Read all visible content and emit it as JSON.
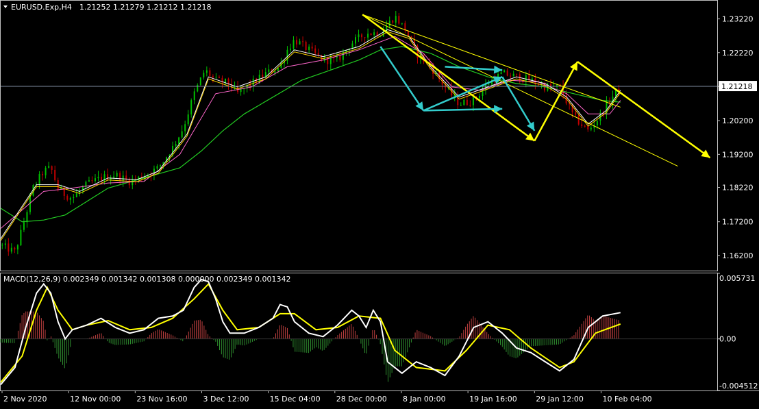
{
  "header": {
    "symbol": "EURUSD.Exp,H4",
    "ohlc": "1.21252 1.21279 1.21212 1.21218"
  },
  "macd_header": "MACD(12,26,9) 0.002349 0.001342 0.001308 0.000000 0.002349 0.001342",
  "colors": {
    "background": "#000000",
    "frame": "#c0c0c0",
    "bull_candle": "#00c000",
    "bear_candle": "#c00000",
    "ma_fast": "#ffffff",
    "ma_mid": "#ffd700",
    "ma_pink": "#ff66cc",
    "ma_slow": "#22cc22",
    "trend_yellow": "#ffff00",
    "trend_cyan": "#33cccc",
    "macd_main": "#ffffff",
    "macd_signal": "#ffff00",
    "hist_pos": "#c04040",
    "hist_neg": "#2f8f2f",
    "price_line": "#7f8ca0"
  },
  "chart_data": [
    {
      "type": "candlestick",
      "title": "EURUSD.Exp,H4",
      "ylim": [
        1.1575,
        1.2372
      ],
      "y_ticks": [
        "1.23220",
        "1.22220",
        "1.21218",
        "1.20200",
        "1.19200",
        "1.18220",
        "1.17200",
        "1.16200"
      ],
      "current_price": "1.21218",
      "x_ticks": [
        "2 Nov 2020",
        "12 Nov 00:00",
        "23 Nov 16:00",
        "3 Dec 12:00",
        "15 Dec 04:00",
        "28 Dec 00:00",
        "8 Jan 00:00",
        "19 Jan 16:00",
        "29 Jan 12:00",
        "10 Feb 04:00"
      ],
      "price_path": [
        [
          0,
          1.165
        ],
        [
          0.02,
          1.163
        ],
        [
          0.03,
          1.17
        ],
        [
          0.045,
          1.182
        ],
        [
          0.06,
          1.187
        ],
        [
          0.07,
          1.188
        ],
        [
          0.08,
          1.182
        ],
        [
          0.09,
          1.18
        ],
        [
          0.1,
          1.179
        ],
        [
          0.12,
          1.183
        ],
        [
          0.14,
          1.185
        ],
        [
          0.16,
          1.186
        ],
        [
          0.18,
          1.184
        ],
        [
          0.2,
          1.1855
        ],
        [
          0.22,
          1.188
        ],
        [
          0.24,
          1.194
        ],
        [
          0.255,
          1.2
        ],
        [
          0.27,
          1.21
        ],
        [
          0.285,
          1.217
        ],
        [
          0.3,
          1.214
        ],
        [
          0.32,
          1.213
        ],
        [
          0.33,
          1.21
        ],
        [
          0.35,
          1.213
        ],
        [
          0.37,
          1.216
        ],
        [
          0.39,
          1.218
        ],
        [
          0.4,
          1.223
        ],
        [
          0.41,
          1.226
        ],
        [
          0.43,
          1.223
        ],
        [
          0.45,
          1.22
        ],
        [
          0.47,
          1.22
        ],
        [
          0.49,
          1.225
        ],
        [
          0.51,
          1.228
        ],
        [
          0.53,
          1.228
        ],
        [
          0.55,
          1.233
        ],
        [
          0.565,
          1.229
        ],
        [
          0.58,
          1.222
        ],
        [
          0.6,
          1.218
        ],
        [
          0.62,
          1.212
        ],
        [
          0.64,
          1.207
        ],
        [
          0.66,
          1.208
        ],
        [
          0.68,
          1.213
        ],
        [
          0.7,
          1.216
        ],
        [
          0.72,
          1.215
        ],
        [
          0.74,
          1.214
        ],
        [
          0.76,
          1.212
        ],
        [
          0.78,
          1.212
        ],
        [
          0.8,
          1.203
        ],
        [
          0.82,
          1.199
        ],
        [
          0.835,
          1.203
        ],
        [
          0.85,
          1.208
        ],
        [
          0.865,
          1.2122
        ]
      ],
      "ma_fast": [
        [
          0,
          1.167
        ],
        [
          0.05,
          1.183
        ],
        [
          0.08,
          1.183
        ],
        [
          0.11,
          1.181
        ],
        [
          0.15,
          1.185
        ],
        [
          0.19,
          1.1845
        ],
        [
          0.22,
          1.187
        ],
        [
          0.26,
          1.198
        ],
        [
          0.29,
          1.215
        ],
        [
          0.33,
          1.212
        ],
        [
          0.37,
          1.215
        ],
        [
          0.41,
          1.223
        ],
        [
          0.45,
          1.221
        ],
        [
          0.5,
          1.224
        ],
        [
          0.54,
          1.229
        ],
        [
          0.57,
          1.227
        ],
        [
          0.6,
          1.218
        ],
        [
          0.64,
          1.209
        ],
        [
          0.68,
          1.212
        ],
        [
          0.72,
          1.215
        ],
        [
          0.76,
          1.213
        ],
        [
          0.79,
          1.209
        ],
        [
          0.82,
          1.201
        ],
        [
          0.845,
          1.205
        ],
        [
          0.865,
          1.211
        ]
      ],
      "ma_pink": [
        [
          0,
          1.17
        ],
        [
          0.06,
          1.181
        ],
        [
          0.1,
          1.182
        ],
        [
          0.15,
          1.1835
        ],
        [
          0.2,
          1.184
        ],
        [
          0.25,
          1.192
        ],
        [
          0.3,
          1.21
        ],
        [
          0.35,
          1.212
        ],
        [
          0.4,
          1.218
        ],
        [
          0.45,
          1.22
        ],
        [
          0.5,
          1.223
        ],
        [
          0.55,
          1.227
        ],
        [
          0.59,
          1.222
        ],
        [
          0.63,
          1.212
        ],
        [
          0.67,
          1.211
        ],
        [
          0.71,
          1.214
        ],
        [
          0.75,
          1.2135
        ],
        [
          0.79,
          1.21
        ],
        [
          0.82,
          1.204
        ],
        [
          0.85,
          1.204
        ],
        [
          0.865,
          1.208
        ]
      ],
      "ma_slow": [
        [
          0,
          1.176
        ],
        [
          0.03,
          1.172
        ],
        [
          0.06,
          1.1725
        ],
        [
          0.09,
          1.174
        ],
        [
          0.12,
          1.178
        ],
        [
          0.15,
          1.182
        ],
        [
          0.2,
          1.185
        ],
        [
          0.25,
          1.188
        ],
        [
          0.28,
          1.193
        ],
        [
          0.31,
          1.199
        ],
        [
          0.34,
          1.204
        ],
        [
          0.38,
          1.209
        ],
        [
          0.42,
          1.214
        ],
        [
          0.46,
          1.217
        ],
        [
          0.5,
          1.22
        ],
        [
          0.53,
          1.223
        ],
        [
          0.56,
          1.224
        ],
        [
          0.6,
          1.222
        ],
        [
          0.64,
          1.218
        ],
        [
          0.68,
          1.215
        ],
        [
          0.72,
          1.213
        ],
        [
          0.76,
          1.212
        ],
        [
          0.8,
          1.21
        ],
        [
          0.84,
          1.208
        ],
        [
          0.865,
          1.2075
        ]
      ],
      "trendlines_yellow_thin": [
        [
          [
            0.505,
            1.2335
          ],
          [
            0.945,
            1.1885
          ]
        ],
        [
          [
            0.505,
            1.2335
          ],
          [
            0.865,
            1.206
          ]
        ]
      ],
      "arrows_yellow": [
        [
          [
            0.505,
            1.2335
          ],
          [
            0.745,
            1.196
          ]
        ],
        [
          [
            0.745,
            1.196
          ],
          [
            0.805,
            1.2195
          ]
        ],
        [
          [
            0.805,
            1.2195
          ],
          [
            0.99,
            1.191
          ]
        ]
      ],
      "arrows_cyan": [
        [
          [
            0.53,
            1.224
          ],
          [
            0.59,
            1.205
          ]
        ],
        [
          [
            0.59,
            1.205
          ],
          [
            0.7,
            1.215
          ]
        ],
        [
          [
            0.59,
            1.205
          ],
          [
            0.7,
            1.2055
          ]
        ],
        [
          [
            0.62,
            1.218
          ],
          [
            0.7,
            1.217
          ]
        ],
        [
          [
            0.7,
            1.215
          ],
          [
            0.745,
            1.199
          ]
        ]
      ]
    },
    {
      "type": "macd",
      "title": "MACD(12,26,9)",
      "ylim": [
        -0.004512,
        0.005731
      ],
      "y_ticks": [
        "0.005731",
        "0.00",
        "-0.004512"
      ],
      "macd_main": [
        [
          0,
          -0.004
        ],
        [
          0.02,
          -0.0025
        ],
        [
          0.035,
          0.001
        ],
        [
          0.05,
          0.004
        ],
        [
          0.06,
          0.0048
        ],
        [
          0.07,
          0.004
        ],
        [
          0.08,
          0.0015
        ],
        [
          0.09,
          0.0
        ],
        [
          0.1,
          0.0008
        ],
        [
          0.12,
          0.0012
        ],
        [
          0.14,
          0.0018
        ],
        [
          0.16,
          0.001
        ],
        [
          0.18,
          0.0005
        ],
        [
          0.2,
          0.0008
        ],
        [
          0.22,
          0.0018
        ],
        [
          0.24,
          0.002
        ],
        [
          0.255,
          0.0025
        ],
        [
          0.27,
          0.0045
        ],
        [
          0.28,
          0.0052
        ],
        [
          0.29,
          0.005
        ],
        [
          0.3,
          0.0035
        ],
        [
          0.31,
          0.0015
        ],
        [
          0.32,
          0.0005
        ],
        [
          0.34,
          0.0005
        ],
        [
          0.36,
          0.001
        ],
        [
          0.38,
          0.0018
        ],
        [
          0.39,
          0.003
        ],
        [
          0.4,
          0.0028
        ],
        [
          0.41,
          0.0015
        ],
        [
          0.43,
          0.0005
        ],
        [
          0.45,
          0.0002
        ],
        [
          0.47,
          0.0012
        ],
        [
          0.49,
          0.0025
        ],
        [
          0.5,
          0.002
        ],
        [
          0.51,
          0.001
        ],
        [
          0.52,
          0.0025
        ],
        [
          0.53,
          0.0015
        ],
        [
          0.54,
          -0.002
        ],
        [
          0.56,
          -0.003
        ],
        [
          0.58,
          -0.002
        ],
        [
          0.6,
          -0.0025
        ],
        [
          0.62,
          -0.0032
        ],
        [
          0.64,
          -0.0015
        ],
        [
          0.66,
          0.001
        ],
        [
          0.68,
          0.0015
        ],
        [
          0.7,
          0.0005
        ],
        [
          0.72,
          -0.0008
        ],
        [
          0.74,
          -0.0012
        ],
        [
          0.76,
          -0.002
        ],
        [
          0.78,
          -0.0028
        ],
        [
          0.8,
          -0.0018
        ],
        [
          0.82,
          0.001
        ],
        [
          0.84,
          0.002
        ],
        [
          0.865,
          0.0023
        ]
      ],
      "macd_signal": [
        [
          0,
          -0.0038
        ],
        [
          0.03,
          -0.0015
        ],
        [
          0.05,
          0.0025
        ],
        [
          0.065,
          0.0045
        ],
        [
          0.08,
          0.0025
        ],
        [
          0.1,
          0.0008
        ],
        [
          0.12,
          0.0012
        ],
        [
          0.15,
          0.0016
        ],
        [
          0.18,
          0.0008
        ],
        [
          0.21,
          0.001
        ],
        [
          0.24,
          0.0018
        ],
        [
          0.27,
          0.0035
        ],
        [
          0.29,
          0.0048
        ],
        [
          0.31,
          0.0025
        ],
        [
          0.33,
          0.0008
        ],
        [
          0.36,
          0.001
        ],
        [
          0.39,
          0.0022
        ],
        [
          0.41,
          0.0022
        ],
        [
          0.44,
          0.0008
        ],
        [
          0.47,
          0.001
        ],
        [
          0.5,
          0.002
        ],
        [
          0.53,
          0.0018
        ],
        [
          0.55,
          -0.001
        ],
        [
          0.58,
          -0.0025
        ],
        [
          0.62,
          -0.0028
        ],
        [
          0.65,
          -0.001
        ],
        [
          0.68,
          0.0012
        ],
        [
          0.71,
          0.0008
        ],
        [
          0.74,
          -0.0008
        ],
        [
          0.78,
          -0.0025
        ],
        [
          0.8,
          -0.002
        ],
        [
          0.83,
          0.0005
        ],
        [
          0.865,
          0.0013
        ]
      ]
    }
  ]
}
